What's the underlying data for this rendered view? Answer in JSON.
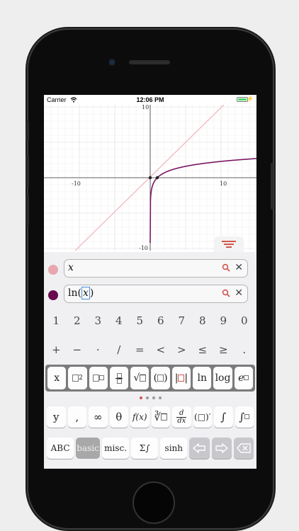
{
  "status": {
    "carrier": "Carrier",
    "time": "12:06 PM"
  },
  "graph": {
    "x_ticks": {
      "neg": "-10",
      "pos": "10"
    },
    "y_ticks": {
      "pos": "10",
      "neg": "-10"
    },
    "colors": {
      "line_x": "#f2b8c0",
      "line_ln": "#7b1660"
    }
  },
  "expressions": [
    {
      "text": "x",
      "color": "#e8a7af"
    },
    {
      "prefix": "ln(",
      "cursor": "x",
      "suffix": ")",
      "color": "#6a0a4e"
    }
  ],
  "keypad": {
    "numbers": [
      "1",
      "2",
      "3",
      "4",
      "5",
      "6",
      "7",
      "8",
      "9",
      "0"
    ],
    "ops": [
      "+",
      "−",
      "·",
      "/",
      "=",
      "<",
      ">",
      "≤",
      "≥",
      "."
    ],
    "templates": {
      "x": "x",
      "sq": "2",
      "sqrt": "√",
      "log_ln": "ln",
      "log": "log",
      "e": "e"
    },
    "funcs": {
      "y": "y",
      "comma": ",",
      "infinity": "∞",
      "theta": "θ",
      "fx": "f(x)",
      "nthroot": "∛",
      "d": "d",
      "dx": "dx",
      "prime": "(□)′",
      "integral": "∫",
      "def_int": "∫"
    },
    "bottom": {
      "abc": "ABC",
      "basic": "basic",
      "misc": "misc.",
      "sigma_int": "Σ∫",
      "sinh": "sinh"
    },
    "accent": "#d0574e"
  }
}
